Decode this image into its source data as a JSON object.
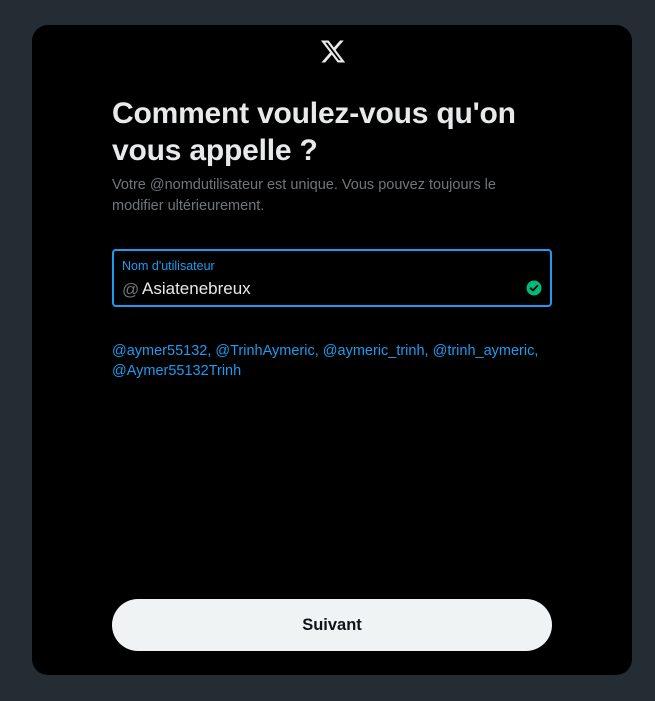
{
  "brand": {
    "logo_icon": "x-logo-icon",
    "accent_color": "#1d9bf0"
  },
  "header": {
    "title": "Comment voulez-vous qu'on vous appelle ?",
    "subtitle": "Votre @nomdutilisateur est unique. Vous pouvez toujours le modifier ultérieurement."
  },
  "username_field": {
    "label": "Nom d'utilisateur",
    "prefix": "@",
    "value": "Asiatenebreux",
    "status_icon": "check-circle-icon",
    "status_color": "#00ba7c"
  },
  "suggestions": [
    "@aymer55132",
    "@TrinhAymeric",
    "@aymeric_trinh",
    "@trinh_aymeric",
    "@Aymer55132Trinh"
  ],
  "footer": {
    "next_label": "Suivant"
  }
}
